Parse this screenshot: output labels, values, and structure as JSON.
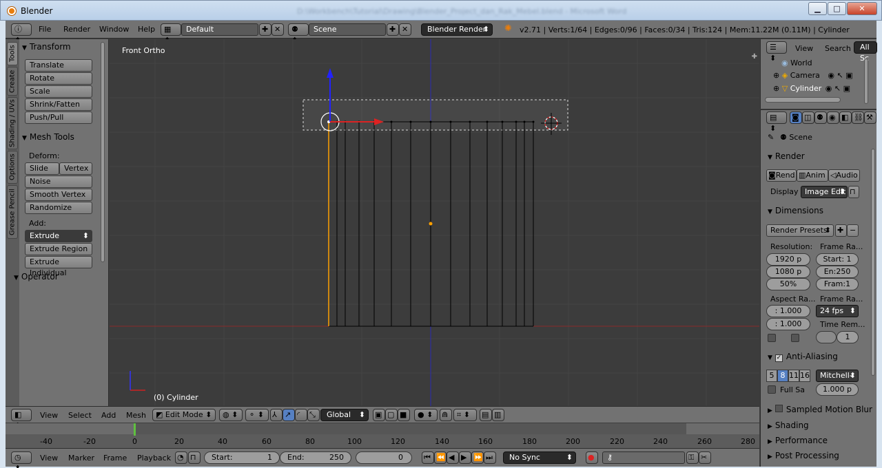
{
  "window": {
    "title": "Blender",
    "blurred_title": "D:\\Workbench\\Tutorial\\Drawing\\Blender_Project_dan_Rak_Mebel.blend - Microsoft Word"
  },
  "info": {
    "menus": [
      "File",
      "Render",
      "Window",
      "Help"
    ],
    "layout": "Default",
    "scene": "Scene",
    "engine": "Blender Render",
    "stats": "v2.71 | Verts:1/64 | Edges:0/96 | Faces:0/34 | Tris:124 | Mem:11.22M (0.11M) | Cylinder"
  },
  "toolshelf": {
    "tabs": [
      "Tools",
      "Create",
      "Shading / UVs",
      "Options",
      "Grease Pencil"
    ],
    "transform": {
      "title": "Transform",
      "buttons": [
        "Translate",
        "Rotate",
        "Scale",
        "Shrink/Fatten",
        "Push/Pull"
      ]
    },
    "mesh_tools": {
      "title": "Mesh Tools",
      "deform_label": "Deform:",
      "slide_edge": "Slide Ed",
      "vertex": "Vertex",
      "deform_buttons": [
        "Noise",
        "Smooth Vertex",
        "Randomize"
      ],
      "add_label": "Add:",
      "extrude": "Extrude",
      "add_buttons": [
        "Extrude Region",
        "Extrude Individual"
      ]
    },
    "operator": "Operator"
  },
  "viewport": {
    "view_label": "Front Ortho",
    "object_label": "(0) Cylinder"
  },
  "viewport_header": {
    "menus": [
      "View",
      "Select",
      "Add",
      "Mesh"
    ],
    "mode": "Edit Mode",
    "orientation": "Global"
  },
  "timeline": {
    "ticks": [
      "-40",
      "-20",
      "0",
      "20",
      "40",
      "60",
      "80",
      "100",
      "120",
      "140",
      "160",
      "180",
      "200",
      "220",
      "240",
      "260",
      "280"
    ],
    "current_frame_marker": 0
  },
  "timeline_header": {
    "menus": [
      "View",
      "Marker",
      "Frame",
      "Playback"
    ],
    "start_label": "Start:",
    "start_value": "1",
    "end_label": "End:",
    "end_value": "250",
    "current_value": "0",
    "sync": "No Sync"
  },
  "outliner": {
    "menus": [
      "View",
      "Search"
    ],
    "filter": "All Sc",
    "items": [
      "World",
      "Camera",
      "Cylinder"
    ]
  },
  "properties": {
    "context": "Scene",
    "render": {
      "title": "Render",
      "render_btn": "Rend",
      "anim_btn": "Anim",
      "audio_btn": "Audio",
      "display_label": "Display",
      "display_value": "Image Edit"
    },
    "dimensions": {
      "title": "Dimensions",
      "presets": "Render Presets",
      "resolution_label": "Resolution:",
      "res_x": "1920 p",
      "res_y": "1080 p",
      "res_pct": "50%",
      "frame_range_label": "Frame Ra...",
      "start": "Start: 1",
      "end": "En:250",
      "step": "Fram:1",
      "aspect_label": "Aspect Ra...",
      "aspect_x": ": 1.000",
      "aspect_y": ": 1.000",
      "frame_rate_label": "Frame Ra...",
      "fps": "24 fps",
      "time_remap_label": "Time Rem...",
      "time_remap_value": "1"
    },
    "anti_aliasing": {
      "title": "Anti-Aliasing",
      "samples": [
        "5",
        "8",
        "11",
        "16"
      ],
      "filter": "Mitchell-",
      "full_sample": "Full Sa",
      "size": "1.000 p"
    },
    "collapsed": [
      "Sampled Motion Blur",
      "Shading",
      "Performance",
      "Post Processing"
    ]
  },
  "colors": {
    "accent_blue": "#5680c2",
    "axis_x": "#cc2222",
    "axis_y": "#3333ff",
    "selected": "#ffa000"
  }
}
